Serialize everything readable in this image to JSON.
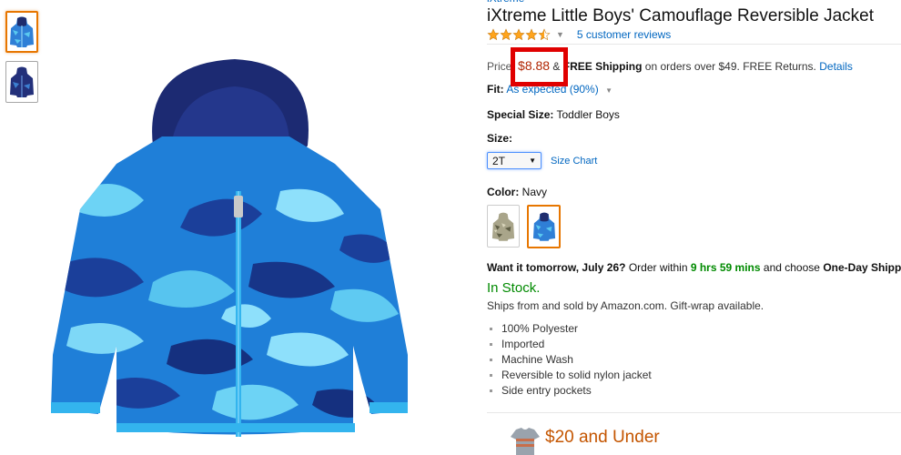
{
  "product": {
    "brand": "iXtreme",
    "title": "iXtreme Little Boys' Camouflage Reversible Jacket",
    "rating_stars": 4.5,
    "reviews_link": "5 customer reviews",
    "price_label": "Price:",
    "price": "$8.88",
    "shipping_amp": "&",
    "shipping_bold": "FREE Shipping",
    "shipping_rest": "on orders over $49. FREE Returns.",
    "details_link": "Details",
    "fit_label": "Fit:",
    "fit_value": "As expected (90%)",
    "special_size_label": "Special Size:",
    "special_size_value": "Toddler Boys",
    "size_label": "Size:",
    "size_selected": "2T",
    "size_chart_link": "Size Chart",
    "color_label": "Color:",
    "color_value": "Navy",
    "delivery_prefix": "Want it tomorrow, July 26?",
    "delivery_mid": "Order within",
    "delivery_time": "9 hrs 59 mins",
    "delivery_suffix": "and choose",
    "delivery_option": "One-Day Shipping",
    "stock": "In Stock.",
    "ships_from": "Ships from and sold by Amazon.com. Gift-wrap available.",
    "features": [
      "100% Polyester",
      "Imported",
      "Machine Wash",
      "Reversible to solid nylon jacket",
      "Side entry pockets"
    ],
    "promo": "$20 and Under"
  },
  "colors": {
    "link": "#0066c0",
    "price": "#b12704",
    "stock": "#008a00",
    "selected_border": "#e77600",
    "highlight": "#e00000",
    "star": "#ffa41c"
  }
}
